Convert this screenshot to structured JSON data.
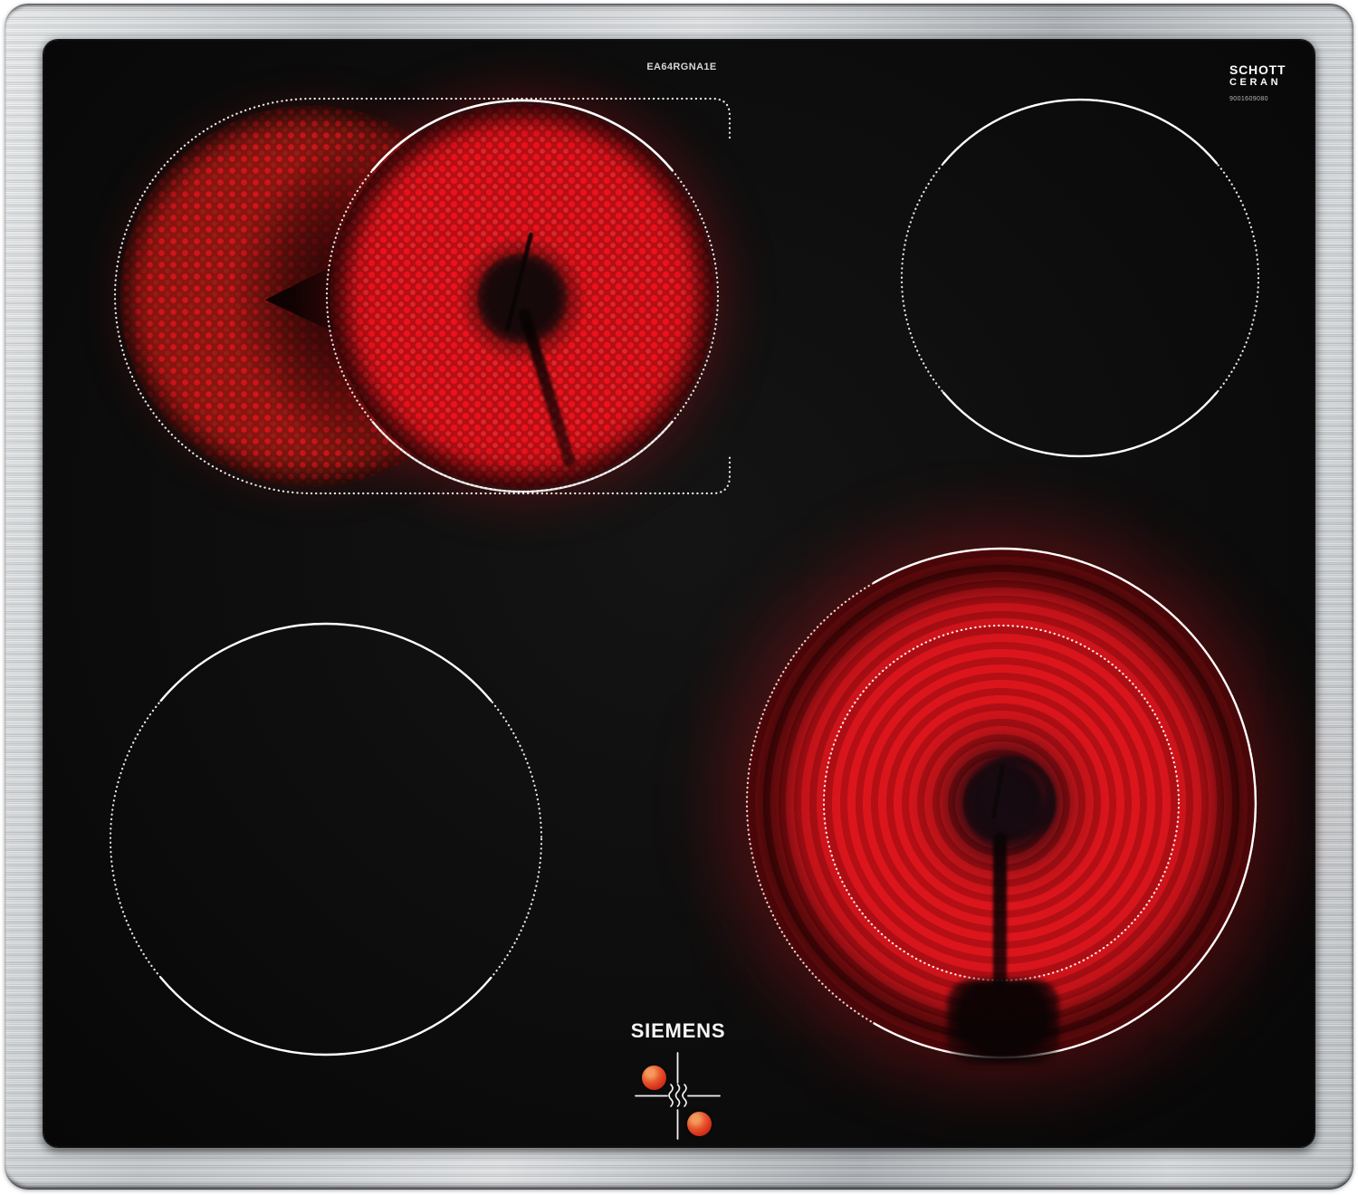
{
  "cooktop": {
    "model_code": "EA64RGNA1E",
    "brand": "SIEMENS",
    "glass_brand": {
      "name_line1": "SCHOTT",
      "name_line2": "CERAN",
      "code": "9001609080"
    },
    "colors": {
      "glass": "#0d0d0d",
      "frame_steel": "#c6c9cc",
      "glow_bright_red": "#f01824",
      "glow_dark_red": "#4e120c",
      "outline_white": "#ffffff",
      "indicator_dot_orange": "#e8562e"
    },
    "zones": [
      {
        "position": "rear-left",
        "type": "dual-roaster-zone-with-extension",
        "state": "on",
        "outline": "dotted stadium around extension, solid+dotted main circle"
      },
      {
        "position": "rear-right",
        "type": "single-zone",
        "state": "off",
        "outline": "solid top/bottom arcs, dotted sides"
      },
      {
        "position": "front-left",
        "type": "single-zone",
        "state": "off",
        "outline": "solid top/bottom arcs, dotted sides"
      },
      {
        "position": "front-right",
        "type": "dual-circuit-zone",
        "state": "on",
        "outline": "solid outer circle with dotted left arc, dotted inner circle"
      }
    ],
    "indicators": {
      "residual_heat_symbol": "three wavy lines in alignment cross",
      "indicator_dots": 2
    }
  }
}
